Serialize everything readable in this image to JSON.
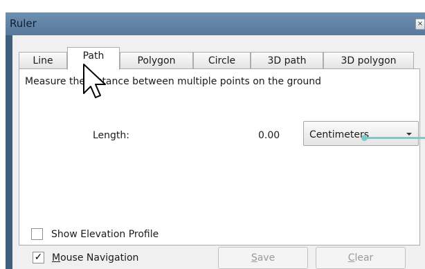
{
  "window": {
    "title": "Ruler",
    "close_glyph": "×"
  },
  "tabs": [
    {
      "label": "Line"
    },
    {
      "label": "Path",
      "active": true
    },
    {
      "label": "Polygon"
    },
    {
      "label": "Circle"
    },
    {
      "label": "3D path"
    },
    {
      "label": "3D polygon"
    }
  ],
  "panel": {
    "description": "Measure the distance between multiple points on the ground",
    "length_label": "Length:",
    "length_value": "0.00",
    "unit_select": {
      "selected": "Centimeters"
    },
    "show_elevation_profile": {
      "label": "Show Elevation Profile",
      "checked": false
    }
  },
  "footer": {
    "mouse_navigation": {
      "label": "Mouse Navigation",
      "checked": true,
      "check_glyph": "✓"
    },
    "save_label": "Save",
    "clear_label": "Clear"
  },
  "colors": {
    "title_bar": "#58799c",
    "window_frame": "#3f5f7c",
    "annotation_line": "#7ec8c8"
  },
  "icons": {
    "cursor": "mouse-pointer-icon",
    "dropdown": "chevron-down-icon",
    "close": "close-icon"
  }
}
